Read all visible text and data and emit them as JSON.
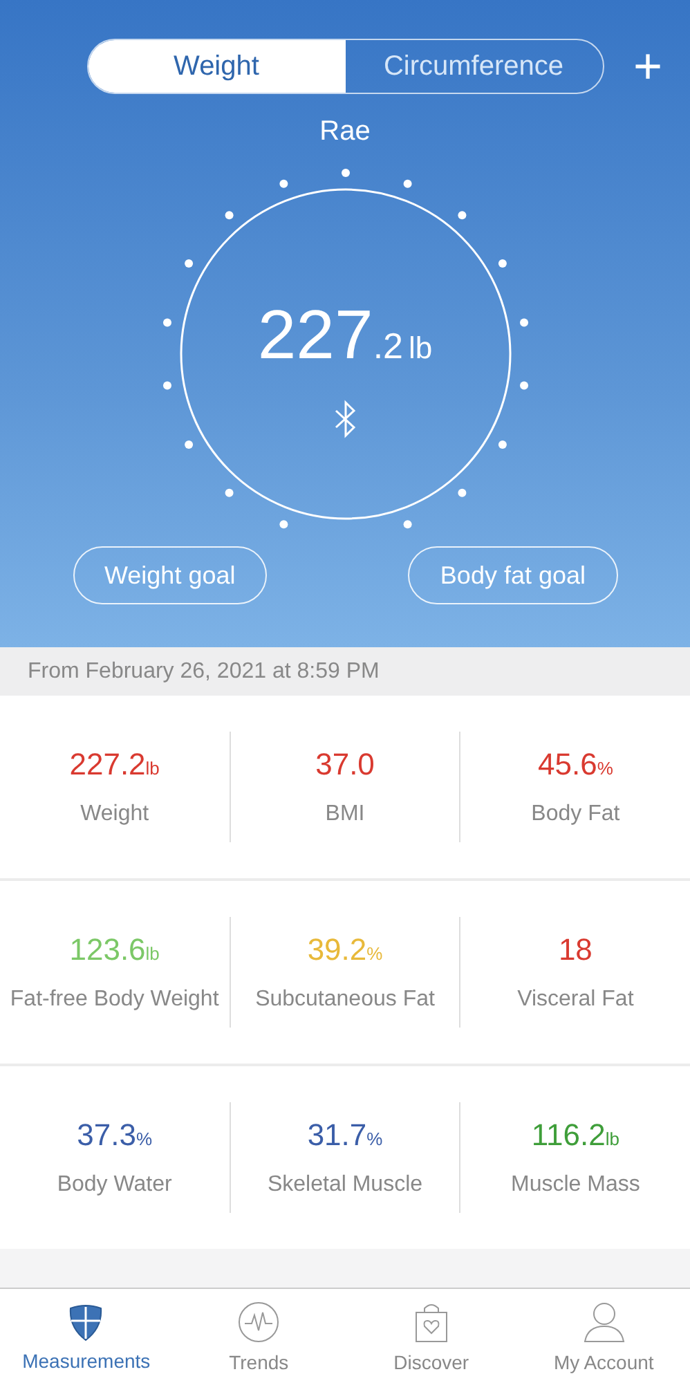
{
  "tabs": [
    {
      "label": "Weight",
      "selected": true
    },
    {
      "label": "Circumference",
      "selected": false
    }
  ],
  "add_button": "+",
  "user_name": "Rae",
  "reading": {
    "value_main": "227",
    "value_decimal": ".2",
    "unit": "lb"
  },
  "goal_buttons": [
    "Weight goal",
    "Body fat goal"
  ],
  "date_line": "From February 26, 2021 at 8:59 PM",
  "metric_rows": [
    [
      {
        "value": "227.2",
        "unit": "lb",
        "label": "Weight",
        "color": "#d93a30"
      },
      {
        "value": "37.0",
        "label": "BMI",
        "color": "#d93a30"
      },
      {
        "value": "45.6",
        "unit": "%",
        "label": "Body Fat",
        "color": "#d93a30"
      }
    ],
    [
      {
        "value": "123.6",
        "unit": "lb",
        "label": "Fat-free Body Weight",
        "color": "#7cc867"
      },
      {
        "value": "39.2",
        "unit": "%",
        "label": "Subcutaneous Fat",
        "color": "#e8b93a"
      },
      {
        "value": "18",
        "label": "Visceral Fat",
        "color": "#d93a30"
      }
    ],
    [
      {
        "value": "37.3",
        "unit": "%",
        "label": "Body Water",
        "color": "#3b5ea8"
      },
      {
        "value": "31.7",
        "unit": "%",
        "label": "Skeletal Muscle",
        "color": "#3b5ea8"
      },
      {
        "value": "116.2",
        "unit": "lb",
        "label": "Muscle Mass",
        "color": "#3f9e3a"
      }
    ]
  ],
  "nav": [
    {
      "label": "Measurements",
      "kind": "shield",
      "selected": true
    },
    {
      "label": "Trends",
      "kind": "pulse",
      "selected": false
    },
    {
      "label": "Discover",
      "kind": "bag",
      "selected": false
    },
    {
      "label": "My Account",
      "kind": "person",
      "selected": false
    }
  ]
}
